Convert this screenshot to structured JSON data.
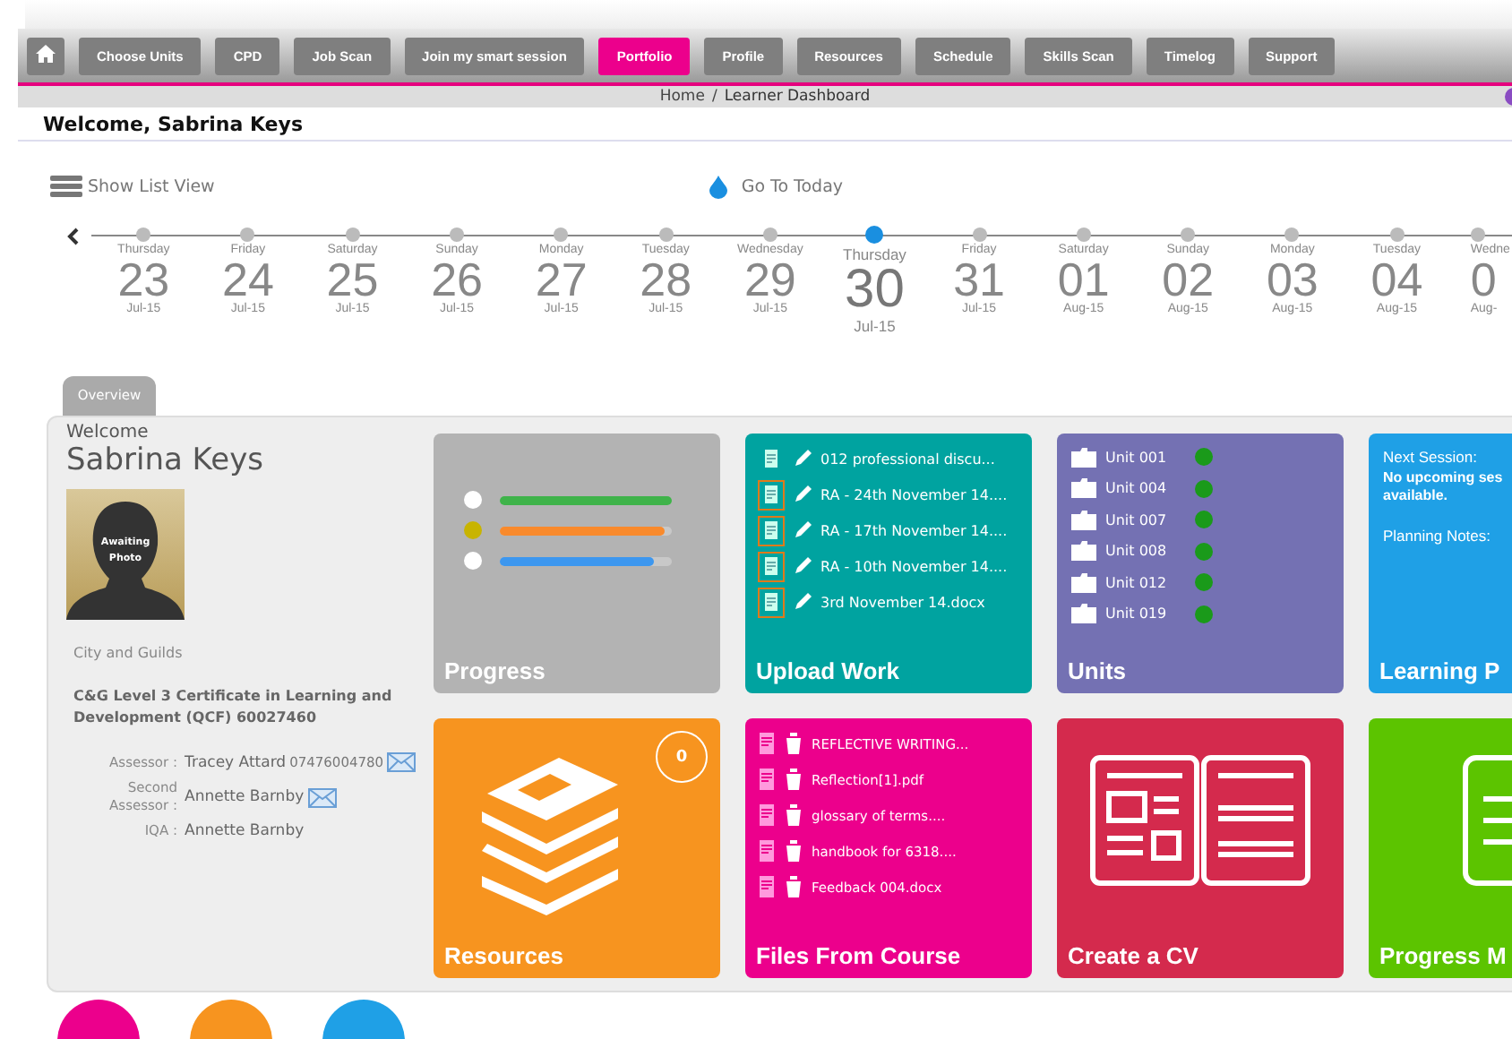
{
  "nav": {
    "items": [
      {
        "label": "Choose Units",
        "selected": false
      },
      {
        "label": "CPD",
        "selected": false
      },
      {
        "label": "Job Scan",
        "selected": false
      },
      {
        "label": "Join my smart session",
        "selected": false
      },
      {
        "label": "Portfolio",
        "selected": true
      },
      {
        "label": "Profile",
        "selected": false
      },
      {
        "label": "Resources",
        "selected": false
      },
      {
        "label": "Schedule",
        "selected": false
      },
      {
        "label": "Skills Scan",
        "selected": false
      },
      {
        "label": "Timelog",
        "selected": false
      },
      {
        "label": "Support",
        "selected": false
      }
    ]
  },
  "breadcrumb": {
    "home": "Home",
    "separator": "/",
    "current": "Learner Dashboard"
  },
  "page_title": "Welcome, Sabrina Keys",
  "list_view_link": "Show List View",
  "today_link": "Go To Today",
  "timeline": {
    "days": [
      {
        "weekday": "Thursday",
        "day": "23",
        "month": "Jul-15",
        "selected": false
      },
      {
        "weekday": "Friday",
        "day": "24",
        "month": "Jul-15",
        "selected": false
      },
      {
        "weekday": "Saturday",
        "day": "25",
        "month": "Jul-15",
        "selected": false
      },
      {
        "weekday": "Sunday",
        "day": "26",
        "month": "Jul-15",
        "selected": false
      },
      {
        "weekday": "Monday",
        "day": "27",
        "month": "Jul-15",
        "selected": false
      },
      {
        "weekday": "Tuesday",
        "day": "28",
        "month": "Jul-15",
        "selected": false
      },
      {
        "weekday": "Wednesday",
        "day": "29",
        "month": "Jul-15",
        "selected": false
      },
      {
        "weekday": "Thursday",
        "day": "30",
        "month": "Jul-15",
        "selected": true
      },
      {
        "weekday": "Friday",
        "day": "31",
        "month": "Jul-15",
        "selected": false
      },
      {
        "weekday": "Saturday",
        "day": "01",
        "month": "Aug-15",
        "selected": false
      },
      {
        "weekday": "Sunday",
        "day": "02",
        "month": "Aug-15",
        "selected": false
      },
      {
        "weekday": "Monday",
        "day": "03",
        "month": "Aug-15",
        "selected": false
      },
      {
        "weekday": "Tuesday",
        "day": "04",
        "month": "Aug-15",
        "selected": false
      },
      {
        "weekday": "Wedne",
        "day": "0",
        "month": "Aug-",
        "selected": false
      }
    ]
  },
  "tab": {
    "label": "Overview",
    "selected": true
  },
  "profile": {
    "greeting": "Welcome",
    "name": "Sabrina Keys",
    "photo_caption": [
      "Awaiting",
      "Photo"
    ],
    "awarding_body": "City and Guilds",
    "qualification": "C&G Level 3 Certificate in Learning and Development (QCF) 60027460",
    "contacts": [
      {
        "role": [
          "Assessor :"
        ],
        "name": "Tracey Attard",
        "phone": "07476004780",
        "mail": true
      },
      {
        "role": [
          "Second",
          "Assessor :"
        ],
        "name": "Annette Barnby",
        "mail": true
      },
      {
        "role": [
          "IQA :"
        ],
        "name": "Annette Barnby",
        "mail": false
      }
    ]
  },
  "tiles": [
    {
      "kind": "progress",
      "title": "Progress",
      "bars": [
        {
          "current": false,
          "level": 1.0,
          "color": "#3fb34a"
        },
        {
          "current": true,
          "level": 0.96,
          "color": "#f98a2c"
        },
        {
          "current": false,
          "level": 0.9,
          "color": "#3d97ef"
        }
      ]
    },
    {
      "kind": "upload",
      "title": "Upload Work",
      "files": [
        {
          "name": "012 professional discu...",
          "highlighted": false
        },
        {
          "name": "RA - 24th November 14....",
          "highlighted": true
        },
        {
          "name": "RA - 17th November 14....",
          "highlighted": true
        },
        {
          "name": "RA - 10th November 14....",
          "highlighted": true
        },
        {
          "name": "3rd November 14.docx",
          "highlighted": true
        }
      ]
    },
    {
      "kind": "units",
      "title": "Units",
      "units": [
        {
          "name": "Unit 001",
          "color": "#1a9a1a"
        },
        {
          "name": "Unit 004",
          "color": "#1a9a1a"
        },
        {
          "name": "Unit 007",
          "color": "#1a9a1a"
        },
        {
          "name": "Unit 008",
          "color": "#1a9a1a"
        },
        {
          "name": "Unit 012",
          "color": "#1a9a1a"
        },
        {
          "name": "Unit 019",
          "color": "#1a9a1a"
        }
      ]
    },
    {
      "kind": "learning",
      "title": "Learning P",
      "next_label": "Next Session:",
      "next_value": "No upcoming ses available.",
      "notes_label": "Planning Notes:"
    },
    {
      "kind": "resources",
      "title": "Resources",
      "count": "0"
    },
    {
      "kind": "files",
      "title": "Files From Course",
      "files": [
        "REFLECTIVE WRITING...",
        "Reflection[1].pdf",
        "glossary of terms....",
        "handbook for 6318....",
        "Feedback 004.docx"
      ]
    },
    {
      "kind": "cv",
      "title": "Create a CV"
    },
    {
      "kind": "progress_m",
      "title": "Progress M"
    }
  ]
}
